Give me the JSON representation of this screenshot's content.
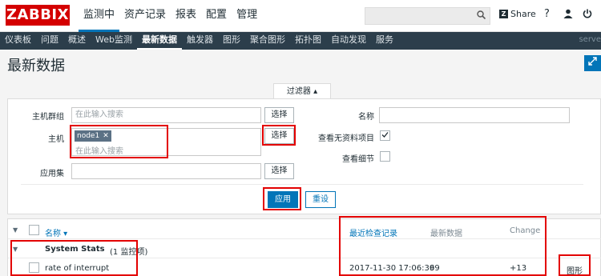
{
  "header": {
    "logo": "ZABBIX",
    "menu": [
      "监测中",
      "资产记录",
      "报表",
      "配置",
      "管理"
    ],
    "share_label": "Share",
    "help_label": "?",
    "user_label": "●",
    "power_label": "⏻"
  },
  "submenu": {
    "items": [
      "仪表板",
      "问题",
      "概述",
      "Web监测",
      "最新数据",
      "触发器",
      "图形",
      "聚合图形",
      "拓扑图",
      "自动发现",
      "服务"
    ],
    "server_label": "serve"
  },
  "page": {
    "title": "最新数据"
  },
  "filter": {
    "tab_label": "过滤器 ▴",
    "host_group_label": "主机群组",
    "host_group_placeholder": "在此输入搜索",
    "host_label": "主机",
    "host_tag": "node1",
    "host_placeholder": "在此输入搜索",
    "app_label": "应用集",
    "select_label": "选择",
    "name_label": "名称",
    "show_no_data_label": "查看无资料项目",
    "show_details_label": "查看细节",
    "apply_label": "应用",
    "reset_label": "重设"
  },
  "table": {
    "headers": {
      "name": "名称 ▾",
      "last_check": "最近检查记录",
      "last_value": "最新数据",
      "change": "Change"
    },
    "group": {
      "name": "System Stats",
      "count": "(1 监控项)"
    },
    "rows": [
      {
        "name": "rate of interrupt",
        "last_check": "2017-11-30 17:06:36",
        "last_value": "99",
        "change": "+13",
        "action": "图形"
      }
    ]
  }
}
